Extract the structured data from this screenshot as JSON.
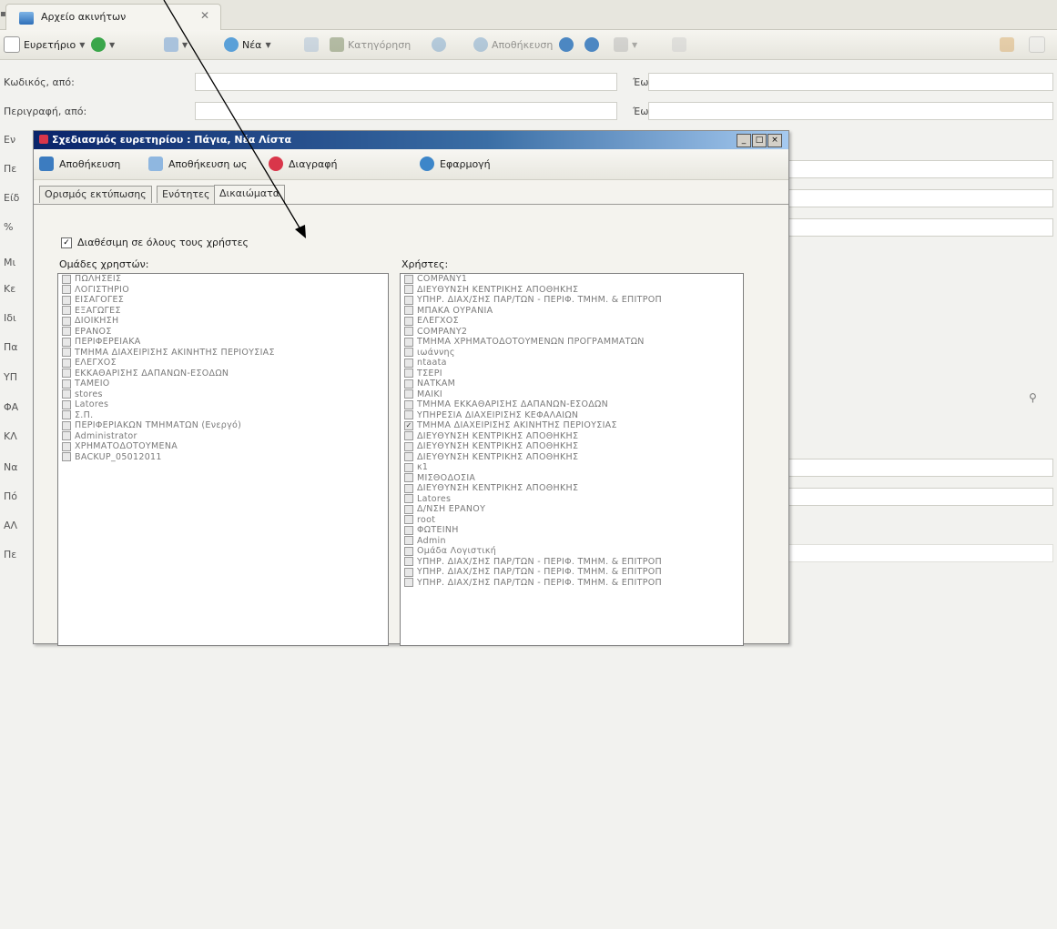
{
  "tab": {
    "title": "Αρχείο ακινήτων",
    "close": "✕"
  },
  "toolbar": {
    "index": "Ευρετήριο",
    "new": "Νέα",
    "category": "Κατηγόρηση",
    "save": "Αποθήκευση"
  },
  "form": {
    "code_from": "Κωδικός, από:",
    "desc_from": "Περιγραφή, από:",
    "to1": "Έως:",
    "to2": "Έως:",
    "side_labels": [
      "Εν",
      "Πε",
      "Είδ",
      "%",
      "Μι",
      "Κε",
      "Ιδι",
      "Πα",
      "ΥΠ",
      "ΦΑ",
      "ΚΛ",
      "Να",
      "Πό",
      "ΑΛ",
      "Πε"
    ]
  },
  "dialog": {
    "title": "Σχεδιασμός ευρετηρίου : Πάγια, Νέα Λίστα",
    "save": "Αποθήκευση",
    "save_as": "Αποθήκευση ως",
    "delete": "Διαγραφή",
    "apply": "Εφαρμογή",
    "tabs": [
      "Ορισμός εκτύπωσης",
      "Ενότητες",
      "Δικαιώματα"
    ],
    "share_label": "Διαθέσιμη σε όλους τους χρήστες",
    "groups_header": "Ομάδες χρηστών:",
    "users_header": "Χρήστες:",
    "groups": [
      "ΠΩΛΗΣΕΙΣ",
      "ΛΟΓΙΣΤΗΡΙΟ",
      "ΕΙΣΑΓΟΓΕΣ",
      "ΕΞΑΓΩΓΕΣ",
      "ΔΙΟΙΚΗΣΗ",
      "ΕΡΑΝΟΣ",
      "ΠΕΡΙΦΕΡΕΙΑΚΑ",
      "ΤΜΗΜΑ ΔΙΑΧΕΙΡΙΣΗΣ ΑΚΙΝΗΤΗΣ ΠΕΡΙΟΥΣΙΑΣ",
      "ΕΛΕΓΧΟΣ",
      "ΕΚΚΑΘΑΡΙΣΗΣ ΔΑΠΑΝΩΝ-ΕΣΟΔΩΝ",
      "ΤΑΜΕΙΟ",
      "stores",
      "Latores",
      "Σ.Π.",
      "ΠΕΡΙΦΕΡΙΑΚΩΝ ΤΜΗΜΑΤΩΝ (Ενεργό)",
      "Administrator",
      "ΧΡΗΜΑΤΟΔΟΤΟΥΜΕΝΑ",
      "BACKUP_05012011"
    ],
    "users": [
      "COMPANY1",
      "ΔΙΕΥΘΥΝΣΗ ΚΕΝΤΡΙΚΗΣ ΑΠΟΘΗΚΗΣ",
      "ΥΠΗΡ. ΔΙΑΧ/ΣΗΣ ΠΑΡ/ΤΩΝ - ΠΕΡΙΦ. ΤΜΗΜ. & ΕΠΙΤΡΟΠ",
      "ΜΠΑΚΑ ΟΥΡΑΝΙΑ",
      "ΕΛΕΓΧΟΣ",
      "COMPANY2",
      "ΤΜΗΜΑ ΧΡΗΜΑΤΟΔΟΤΟΥΜΕΝΩΝ ΠΡΟΓΡΑΜΜΑΤΩΝ",
      "ιωάννης",
      "ntaata",
      "ΤΣΕΡΙ",
      "ΝΑΤΚΑΜ",
      "ΜΑΙΚΙ",
      "ΤΜΗΜΑ ΕΚΚΑΘΑΡΙΣΗΣ ΔΑΠΑΝΩΝ-ΕΣΟΔΩΝ",
      "ΥΠΗΡΕΣΙΑ ΔΙΑΧΕΙΡΙΣΗΣ ΚΕΦΑΛΑΙΩΝ",
      "ΤΜΗΜΑ ΔΙΑΧΕΙΡΙΣΗΣ ΑΚΙΝΗΤΗΣ ΠΕΡΙΟΥΣΙΑΣ",
      "ΔΙΕΥΘΥΝΣΗ ΚΕΝΤΡΙΚΗΣ ΑΠΟΘΗΚΗΣ",
      "ΔΙΕΥΘΥΝΣΗ ΚΕΝΤΡΙΚΗΣ ΑΠΟΘΗΚΗΣ",
      "ΔΙΕΥΘΥΝΣΗ ΚΕΝΤΡΙΚΗΣ ΑΠΟΘΗΚΗΣ",
      "κ1",
      "ΜΙΣΘΟΔΟΣΙΑ",
      "ΔΙΕΥΘΥΝΣΗ ΚΕΝΤΡΙΚΗΣ ΑΠΟΘΗΚΗΣ",
      "Latores",
      "Δ/ΝΣΗ ΕΡΑΝΟΥ",
      "root",
      "ΦΩΤΕΙΝΗ",
      "Admin",
      "Ομάδα Λογιστική",
      "ΥΠΗΡ. ΔΙΑΧ/ΣΗΣ ΠΑΡ/ΤΩΝ - ΠΕΡΙΦ. ΤΜΗΜ. & ΕΠΙΤΡΟΠ",
      "ΥΠΗΡ. ΔΙΑΧ/ΣΗΣ ΠΑΡ/ΤΩΝ - ΠΕΡΙΦ. ΤΜΗΜ. & ΕΠΙΤΡΟΠ",
      "ΥΠΗΡ. ΔΙΑΧ/ΣΗΣ ΠΑΡ/ΤΩΝ - ΠΕΡΙΦ. ΤΜΗΜ. & ΕΠΙΤΡΟΠ"
    ],
    "checked_user_index": 14
  },
  "colors": {
    "title_bar": "#0a246a",
    "accent_green": "#3aa64a",
    "accent_red": "#d9364a"
  }
}
